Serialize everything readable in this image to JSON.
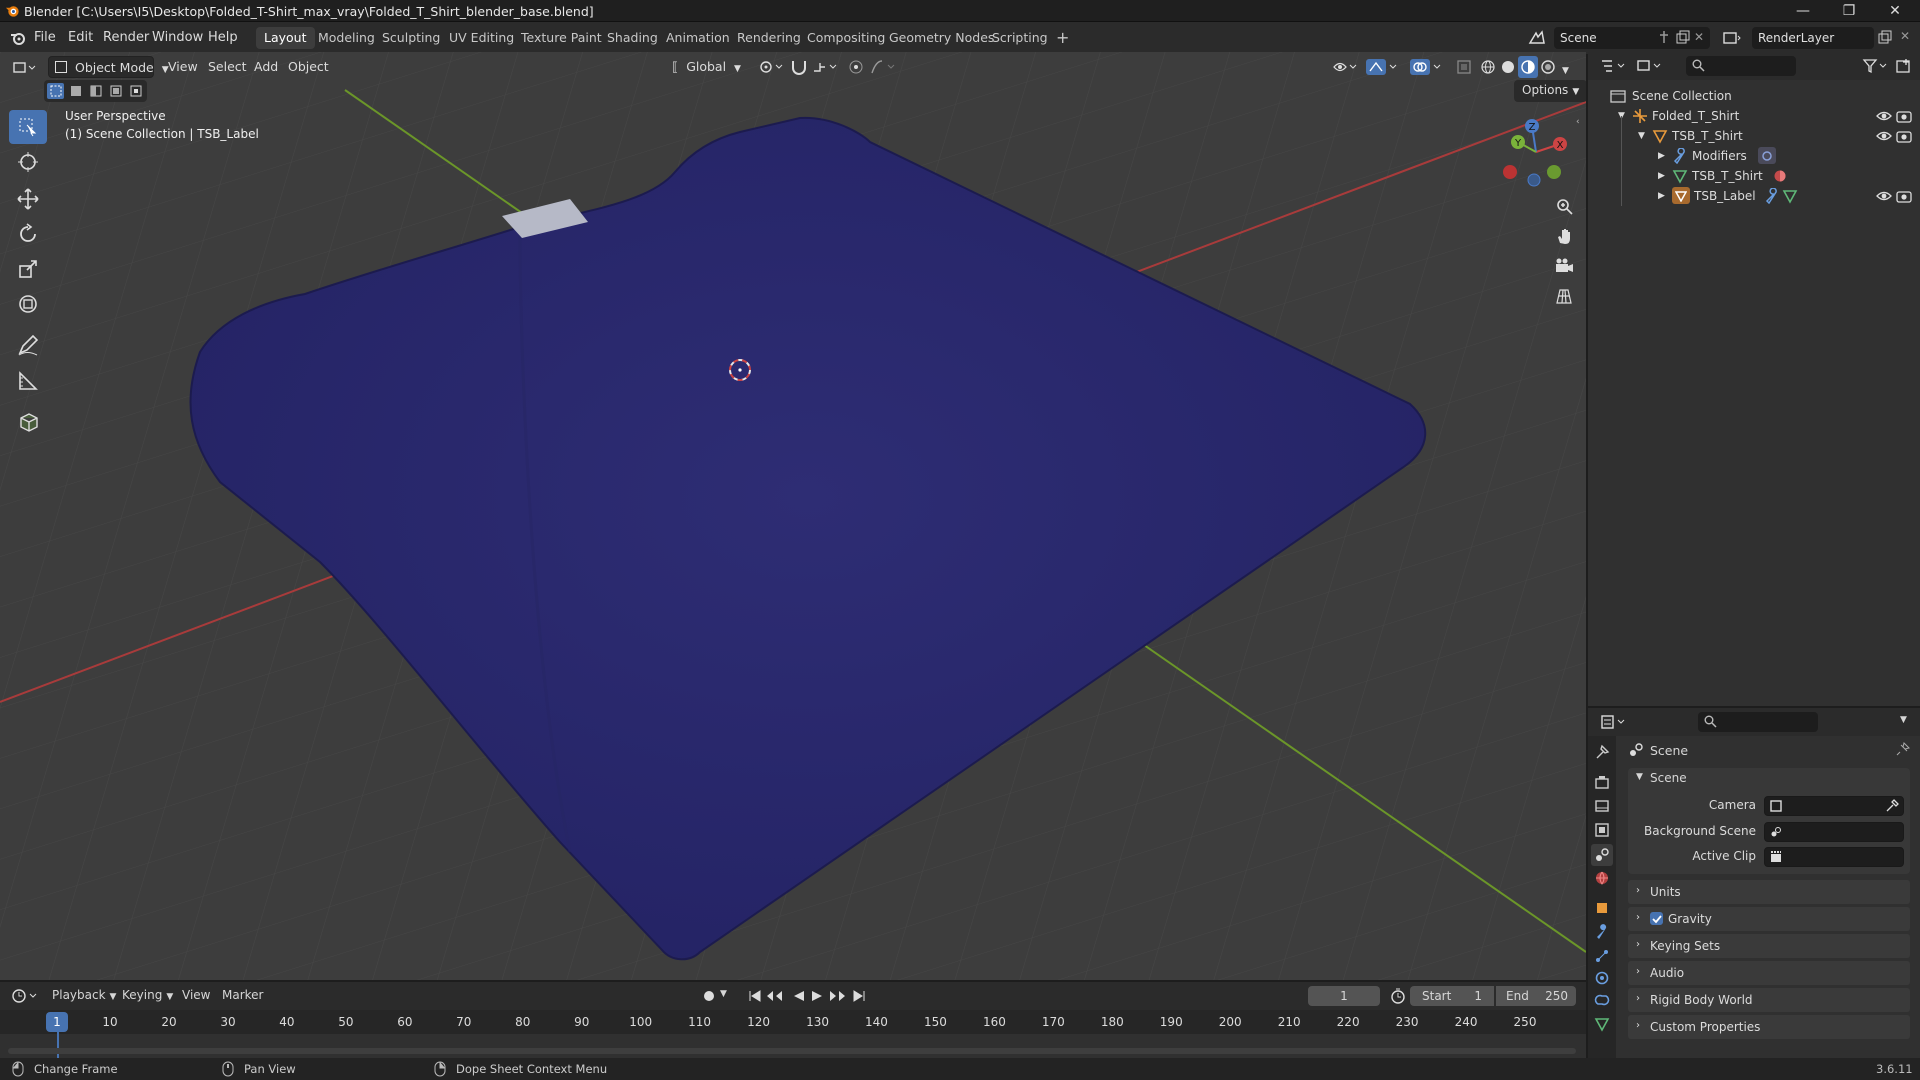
{
  "window": {
    "title": "Blender [C:\\Users\\I5\\Desktop\\Folded_T-Shirt_max_vray\\Folded_T_Shirt_blender_base.blend]"
  },
  "menu": {
    "file": "File",
    "edit": "Edit",
    "render": "Render",
    "window": "Window",
    "help": "Help"
  },
  "workspaces": [
    "Layout",
    "Modeling",
    "Sculpting",
    "UV Editing",
    "Texture Paint",
    "Shading",
    "Animation",
    "Rendering",
    "Compositing",
    "Geometry Nodes",
    "Scripting"
  ],
  "scene_selector": {
    "value": "Scene"
  },
  "view_layer": {
    "value": "RenderLayer"
  },
  "viewport": {
    "mode": "Object Mode",
    "view": "View",
    "select": "Select",
    "add": "Add",
    "object": "Object",
    "transform_orientation": "Global",
    "options": "Options",
    "overlay_title": "User Perspective",
    "overlay_collection": "(1) Scene Collection | TSB_Label",
    "gizmo": {
      "x": "X",
      "y": "Y",
      "z": "Z"
    }
  },
  "outliner": {
    "root": "Scene Collection",
    "items": [
      {
        "label": "Folded_T_Shirt"
      },
      {
        "label": "TSB_T_Shirt"
      },
      {
        "label": "Modifiers"
      },
      {
        "label": "TSB_T_Shirt"
      },
      {
        "label": "TSB_Label"
      }
    ]
  },
  "properties": {
    "context": "Scene",
    "section": "Scene",
    "camera_label": "Camera",
    "background_scene_label": "Background Scene",
    "active_clip_label": "Active Clip",
    "panels": [
      "Units",
      "Gravity",
      "Keying Sets",
      "Audio",
      "Rigid Body World",
      "Custom Properties"
    ],
    "gravity_checked": true
  },
  "timeline": {
    "playback": "Playback",
    "keying": "Keying",
    "view": "View",
    "marker": "Marker",
    "current_frame": "1",
    "start_label": "Start",
    "start": "1",
    "end_label": "End",
    "end": "250",
    "ticks": [
      "1",
      "10",
      "20",
      "30",
      "40",
      "50",
      "60",
      "70",
      "80",
      "90",
      "100",
      "110",
      "120",
      "130",
      "140",
      "150",
      "160",
      "170",
      "180",
      "190",
      "200",
      "210",
      "220",
      "230",
      "240",
      "250"
    ]
  },
  "statusbar": {
    "change_frame": "Change Frame",
    "pan_view": "Pan View",
    "context_menu": "Dope Sheet Context Menu",
    "version": "3.6.11"
  },
  "colors": {
    "accent": "#4773b1",
    "shirt": "#2b2a6e",
    "grid_bg": "#3d3d3d",
    "panel": "#303030",
    "x_axis": "#c8423f",
    "y_axis": "#7aa533"
  }
}
